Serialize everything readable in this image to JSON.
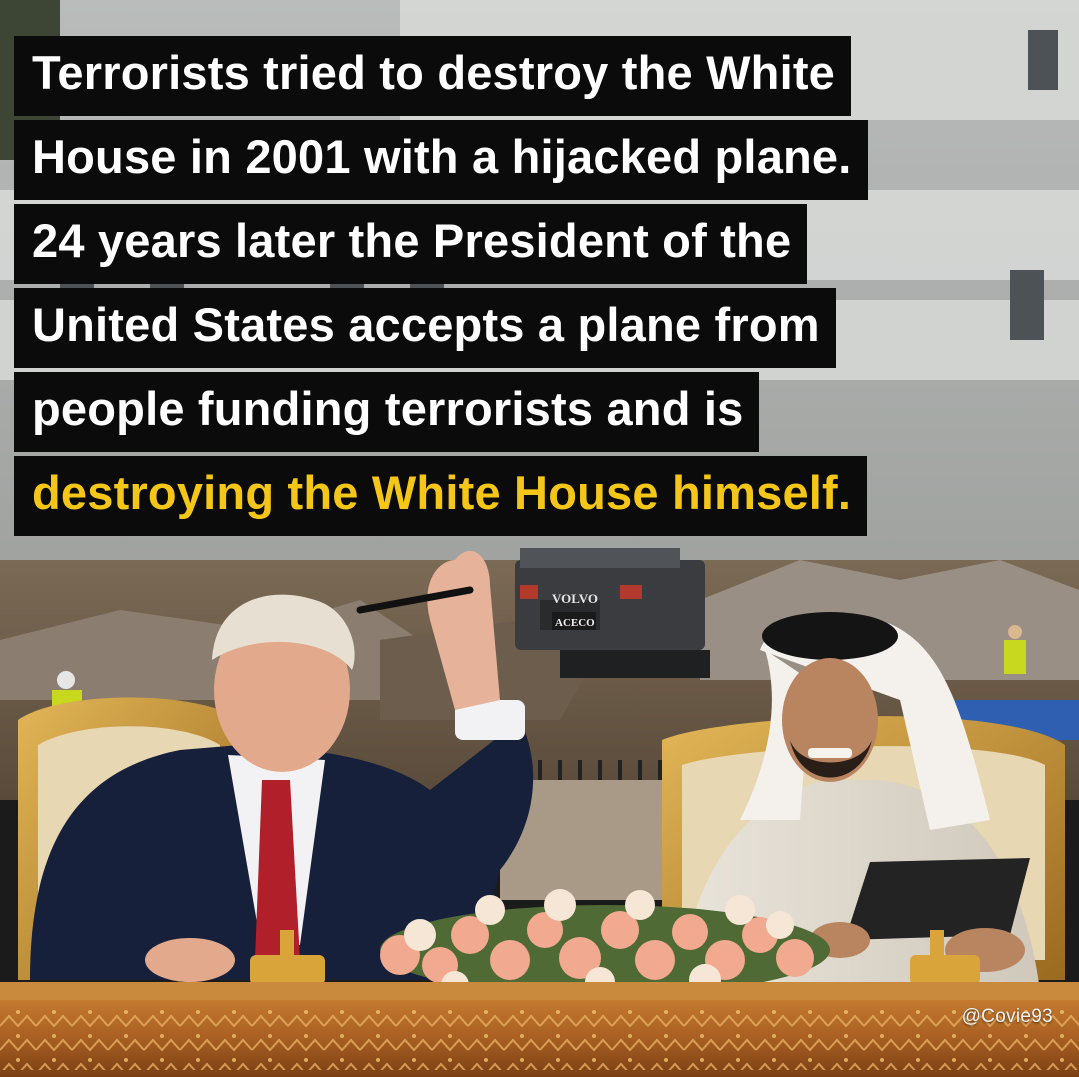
{
  "caption": {
    "lines": [
      "Terrorists tried to destroy the White",
      "House in 2001 with a hijacked plane.",
      "24 years later the President of the",
      "United States accepts a plane from",
      "people funding terrorists and is"
    ],
    "highlight_line": "destroying the White House himself."
  },
  "excavator": {
    "brand": "VOLVO",
    "company": "ACECO"
  },
  "watermark": "@Covie93",
  "colors": {
    "caption_text": "#ffffff",
    "caption_highlight": "#f4c617",
    "caption_background": "#0b0b0b"
  }
}
